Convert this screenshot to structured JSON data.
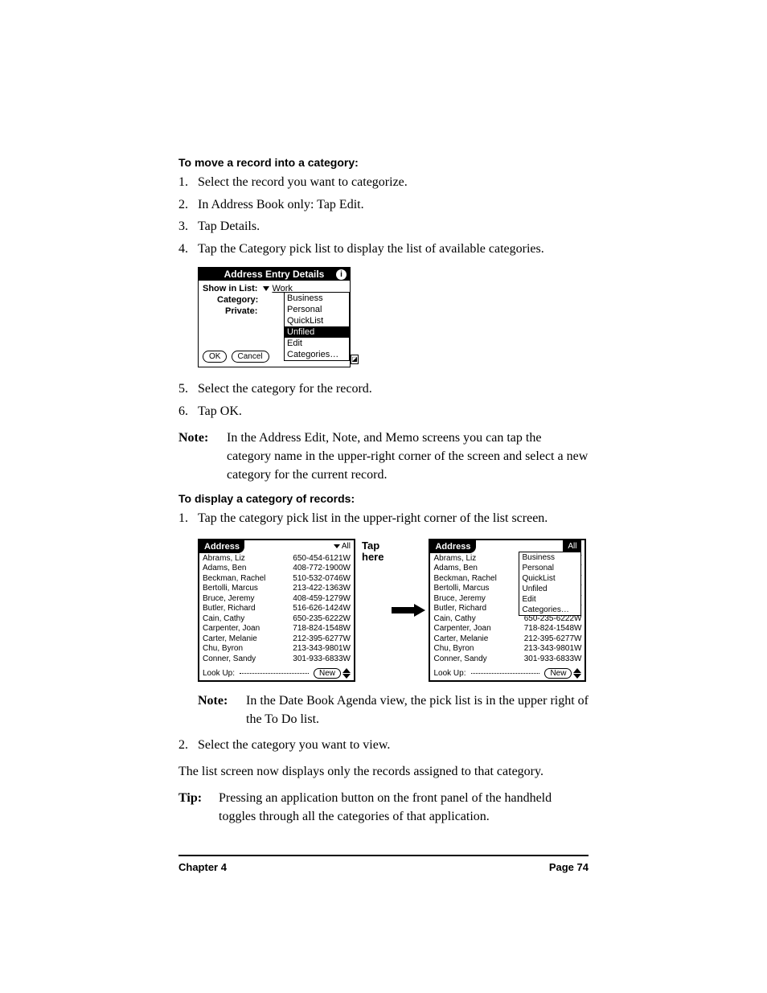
{
  "headings": {
    "move": "To move a record into a category:",
    "display": "To display a category of records:"
  },
  "steps_move": [
    "Select the record you want to categorize.",
    "In Address Book only: Tap Edit.",
    "Tap Details.",
    "Tap the Category pick list to display the list of available categories.",
    "Select the category for the record.",
    "Tap OK."
  ],
  "steps_display": [
    "Tap the category pick list in the upper-right corner of the list screen.",
    "Select the category you want to view."
  ],
  "notes": {
    "note1_label": "Note:",
    "note1_text": "In the Address Edit, Note, and Memo screens you can tap the category name in the upper-right corner of the screen and select a new category for the current record.",
    "note2_label": "Note:",
    "note2_text": "In the Date Book Agenda view, the pick list is in the upper right of the To Do list.",
    "tip_label": "Tip:",
    "tip_text": "Pressing an application button on the front panel of the handheld toggles through all the categories of that application."
  },
  "body_after": "The list screen now displays only the records assigned to that category.",
  "dialog1": {
    "title": "Address Entry Details",
    "info_icon": "i",
    "show_label": "Show in List:",
    "show_value": "Work",
    "category_label": "Category:",
    "private_label": "Private:",
    "ok": "OK",
    "cancel": "Cancel",
    "options": [
      "Business",
      "Personal",
      "QuickList",
      "Unfiled",
      "Edit Categories…"
    ],
    "selected": "Unfiled"
  },
  "tap_here": "Tap here",
  "address_screen": {
    "title": "Address",
    "category_all": "All",
    "lookup": "Look Up:",
    "new_btn": "New",
    "contacts": [
      {
        "name": "Abrams, Liz",
        "phone": "650-454-6121W"
      },
      {
        "name": "Adams, Ben",
        "phone": "408-772-1900W"
      },
      {
        "name": "Beckman, Rachel",
        "phone": "510-532-0746W"
      },
      {
        "name": "Bertolli, Marcus",
        "phone": "213-422-1363W"
      },
      {
        "name": "Bruce, Jeremy",
        "phone": "408-459-1279W"
      },
      {
        "name": "Butler, Richard",
        "phone": "516-626-1424W"
      },
      {
        "name": "Cain, Cathy",
        "phone": "650-235-6222W"
      },
      {
        "name": "Carpenter, Joan",
        "phone": "718-824-1548W"
      },
      {
        "name": "Carter, Melanie",
        "phone": "212-395-6277W"
      },
      {
        "name": "Chu, Byron",
        "phone": "213-343-9801W"
      },
      {
        "name": "Conner, Sandy",
        "phone": "301-933-6833W"
      }
    ],
    "menu": [
      "Business",
      "Personal",
      "QuickList",
      "Unfiled",
      "Edit Categories…"
    ]
  },
  "footer": {
    "chapter": "Chapter 4",
    "page": "Page 74"
  }
}
